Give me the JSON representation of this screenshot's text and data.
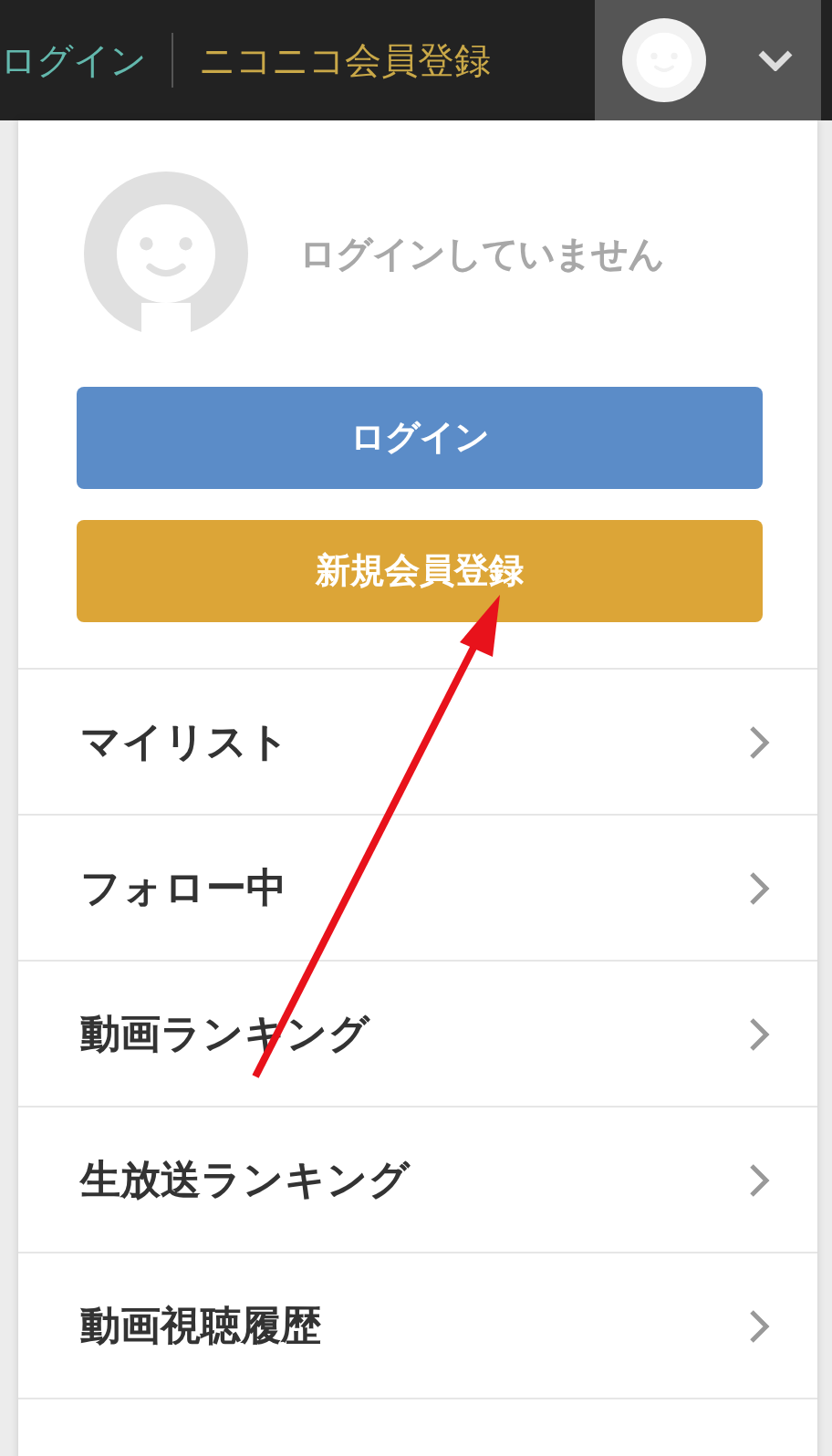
{
  "header": {
    "links": [
      {
        "label": "ログイン",
        "kind": "login"
      },
      {
        "label": "ニコニコ会員登録",
        "kind": "register"
      }
    ]
  },
  "account_menu": {
    "status": "ログインしていません",
    "buttons": [
      {
        "label": "ログイン",
        "kind": "login"
      },
      {
        "label": "新規会員登録",
        "kind": "register"
      }
    ],
    "items": [
      {
        "label": "マイリスト"
      },
      {
        "label": "フォロー中"
      },
      {
        "label": "動画ランキング"
      },
      {
        "label": "生放送ランキング"
      },
      {
        "label": "動画視聴履歴"
      }
    ]
  }
}
